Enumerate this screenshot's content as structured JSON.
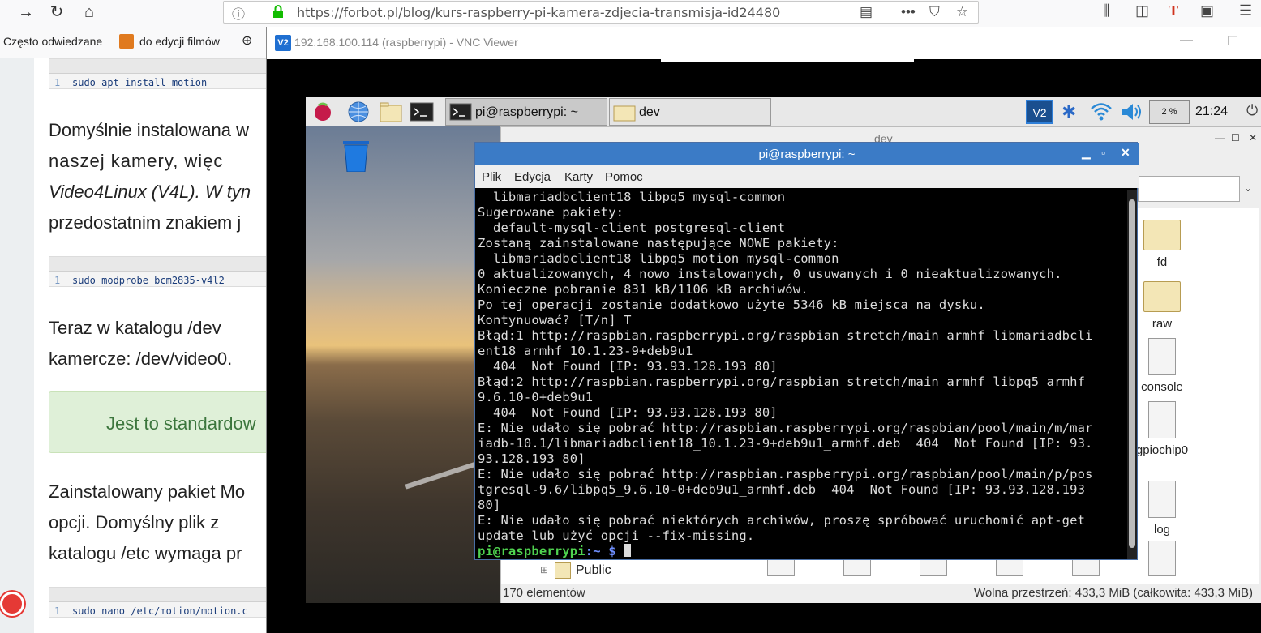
{
  "browser": {
    "url": "https://forbot.pl/blog/kurs-raspberry-pi-kamera-zdjecia-transmisja-id24480",
    "bookmarks": [
      "Często odwiedzane",
      "do edycji filmów"
    ]
  },
  "page": {
    "code1": "sudo apt install motion",
    "code2": "sudo modprobe bcm2835-v4l2",
    "code3": "sudo nano /etc/motion/motion.c",
    "line_no": "1",
    "para1": [
      "Domyślnie instalowana w",
      "naszej   kamery,   więc",
      "Video4Linux (V4L). W tyn",
      "przedostatnim znakiem j"
    ],
    "para2": [
      "Teraz  w  katalogu  /dev",
      "kamercze: /dev/video0."
    ],
    "note": "Jest to standardow",
    "para3": [
      "Zainstalowany pakiet Mo",
      "opcji.  Domyślny  plik  z",
      "katalogu /etc wymaga pr"
    ]
  },
  "vnc": {
    "title": "192.168.100.114 (raspberrypi) - VNC Viewer",
    "pi": {
      "taskbar": {
        "terminal_task": "pi@raspberrypi: ~",
        "folder_task": "dev",
        "cpu": "2 %",
        "clock": "21:24"
      },
      "file_manager": {
        "title": "dev",
        "items": [
          "fd",
          "raw",
          "console",
          "gpiochip0",
          "log"
        ],
        "tree_item": "Public",
        "status_left": "170 elementów",
        "status_right": "Wolna przestrzeń: 433,3 MiB (całkowita: 433,3 MiB)"
      },
      "terminal": {
        "title": "pi@raspberrypi: ~",
        "menu": [
          "Plik",
          "Edycja",
          "Karty",
          "Pomoc"
        ],
        "lines": [
          "  libmariadbclient18 libpq5 mysql-common",
          "Sugerowane pakiety:",
          "  default-mysql-client postgresql-client",
          "Zostaną zainstalowane następujące NOWE pakiety:",
          "  libmariadbclient18 libpq5 motion mysql-common",
          "0 aktualizowanych, 4 nowo instalowanych, 0 usuwanych i 0 nieaktualizowanych.",
          "Konieczne pobranie 831 kB/1106 kB archiwów.",
          "Po tej operacji zostanie dodatkowo użyte 5346 kB miejsca na dysku.",
          "Kontynuować? [T/n] T",
          "Błąd:1 http://raspbian.raspberrypi.org/raspbian stretch/main armhf libmariadbcli",
          "ent18 armhf 10.1.23-9+deb9u1",
          "  404  Not Found [IP: 93.93.128.193 80]",
          "Błąd:2 http://raspbian.raspberrypi.org/raspbian stretch/main armhf libpq5 armhf",
          "9.6.10-0+deb9u1",
          "  404  Not Found [IP: 93.93.128.193 80]",
          "E: Nie udało się pobrać http://raspbian.raspberrypi.org/raspbian/pool/main/m/mar",
          "iadb-10.1/libmariadbclient18_10.1.23-9+deb9u1_armhf.deb  404  Not Found [IP: 93.",
          "93.128.193 80]",
          "E: Nie udało się pobrać http://raspbian.raspberrypi.org/raspbian/pool/main/p/pos",
          "tgresql-9.6/libpq5_9.6.10-0+deb9u1_armhf.deb  404  Not Found [IP: 93.93.128.193",
          "80]",
          "E: Nie udało się pobrać niektórych archiwów, proszę spróbować uruchomić apt-get",
          "update lub użyć opcji --fix-missing."
        ],
        "prompt_user": "pi@raspberrypi",
        "prompt_path": ":~ $"
      }
    }
  },
  "colors": {
    "terminal_title": "#3b7bc6",
    "prompt_user": "#4fd24f",
    "prompt_path": "#6f8fff",
    "note_bg": "#dff0d8"
  }
}
